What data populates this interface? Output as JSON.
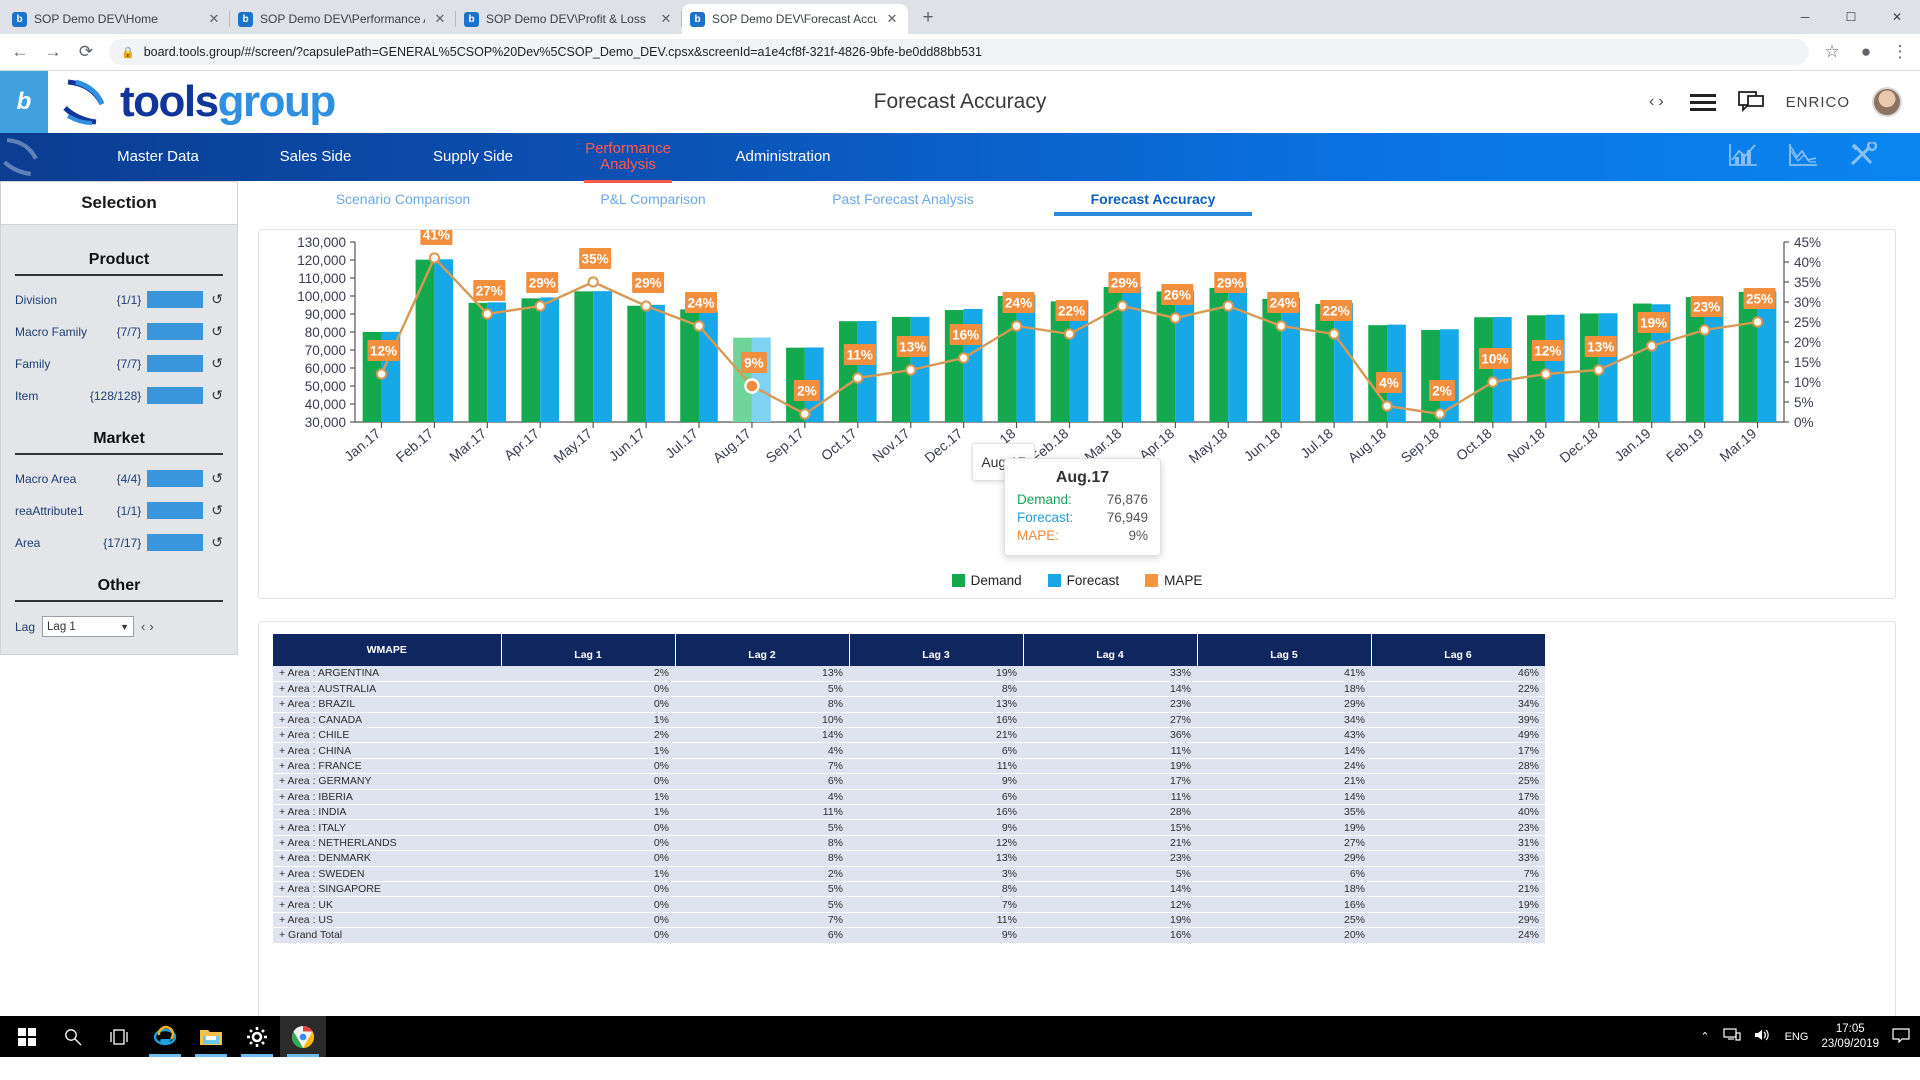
{
  "browser": {
    "tabs": [
      {
        "title": "SOP Demo DEV\\Home",
        "active": false
      },
      {
        "title": "SOP Demo DEV\\Performance An",
        "active": false
      },
      {
        "title": "SOP Demo DEV\\Profit & Loss",
        "active": false
      },
      {
        "title": "SOP Demo DEV\\Forecast Accura",
        "active": true
      }
    ],
    "favicon_letter": "b",
    "close_label": "✕",
    "newtab_label": "+",
    "window_controls": {
      "minimize": "─",
      "maximize": "☐",
      "close": "✕"
    },
    "back_icon": "←",
    "forward_icon": "→",
    "reload_icon": "⟳",
    "lock_icon": "🔒",
    "url": "board.tools.group/#/screen/?capsulePath=GENERAL%5CSOP%20Dev%5CSOP_Demo_DEV.cpsx&screenId=a1e4cf8f-321f-4826-9bfe-be0dd88bb531",
    "star_icon": "☆",
    "profile_icon": "●",
    "menu_icon": "⋮"
  },
  "app_header": {
    "badge_letter": "b",
    "logo_tools": "tools",
    "logo_group": "group",
    "title": "Forecast Accuracy",
    "prev_arrow": "‹",
    "next_arrow": "›",
    "user_name": "ENRICO"
  },
  "nav": {
    "items": [
      {
        "label": "Master Data",
        "active": false
      },
      {
        "label": "Sales Side",
        "active": false
      },
      {
        "label": "Supply Side",
        "active": false
      },
      {
        "label": "Performance\nAnalysis",
        "active": true
      },
      {
        "label": "Administration",
        "active": false
      }
    ],
    "active_color": "#ff5a4d"
  },
  "subtabs": [
    {
      "label": "Scenario Comparison",
      "active": false
    },
    {
      "label": "P&L Comparison",
      "active": false
    },
    {
      "label": "Past Forecast Analysis",
      "active": false
    },
    {
      "label": "Forecast Accuracy",
      "active": true
    }
  ],
  "sidebar": {
    "title": "Selection",
    "sections": [
      {
        "name": "Product",
        "rows": [
          {
            "label": "Division",
            "count": "{1/1}"
          },
          {
            "label": "Macro Family",
            "count": "{7/7}"
          },
          {
            "label": "Family",
            "count": "{7/7}"
          },
          {
            "label": "Item",
            "count": "{128/128}"
          }
        ]
      },
      {
        "name": "Market",
        "rows": [
          {
            "label": "Macro Area",
            "count": "{4/4}"
          },
          {
            "label": "reaAttribute1",
            "count": "{1/1}"
          },
          {
            "label": "Area",
            "count": "{17/17}"
          }
        ]
      }
    ],
    "other": {
      "name": "Other",
      "lag_label": "Lag",
      "lag_value": "Lag 1",
      "caret": "▼",
      "prev": "‹",
      "next": "›"
    },
    "reset_icon": "↺"
  },
  "tooltip": {
    "ghost_label": "Aug.17",
    "title": "Aug.17",
    "rows": [
      {
        "key": "Demand:",
        "value": "76,876"
      },
      {
        "key": "Forecast:",
        "value": "76,949"
      },
      {
        "key": "MAPE:",
        "value": "9%"
      }
    ]
  },
  "chart_data": {
    "type": "bar",
    "title": "",
    "xlabel": "",
    "ylabel": "",
    "y_left_label": "",
    "y_right_label": "",
    "ylim": [
      30000,
      130000
    ],
    "y2lim": [
      0,
      45
    ],
    "grid": false,
    "legend_position": "bottom",
    "highlighted_category": "Aug.17",
    "y_left_ticks": [
      "130,000",
      "120,000",
      "110,000",
      "100,000",
      "90,000",
      "80,000",
      "70,000",
      "60,000",
      "50,000",
      "40,000",
      "30,000"
    ],
    "y_right_ticks": [
      "45%",
      "40%",
      "35%",
      "30%",
      "25%",
      "20%",
      "15%",
      "10%",
      "5%",
      "0%"
    ],
    "categories": [
      "Jan.17",
      "Feb.17",
      "Mar.17",
      "Apr.17",
      "May.17",
      "Jun.17",
      "Jul.17",
      "Aug.17",
      "Sep.17",
      "Oct.17",
      "Nov.17",
      "Dec.17",
      "Jan.18",
      "Feb.18",
      "Mar.18",
      "Apr.18",
      "May.18",
      "Jun.18",
      "Jul.18",
      "Aug.18",
      "Sep.18",
      "Oct.18",
      "Nov.18",
      "Dec.18",
      "Jan.19",
      "Feb.19",
      "Mar.19"
    ],
    "series": [
      {
        "name": "Demand",
        "color": "#15a94f",
        "type": "bar",
        "values": [
          80000,
          120200,
          96200,
          98700,
          102600,
          94600,
          92600,
          76876,
          71300,
          86000,
          88400,
          92200,
          100000,
          97000,
          105000,
          102500,
          104500,
          98400,
          95600,
          83800,
          81100,
          88200,
          89300,
          90300,
          95800,
          99400,
          102300
        ]
      },
      {
        "name": "Forecast",
        "color": "#17a8e8",
        "type": "bar",
        "values": [
          80100,
          120400,
          96500,
          99200,
          102700,
          95100,
          91500,
          76949,
          71400,
          86100,
          88400,
          92800,
          100400,
          97400,
          105200,
          102900,
          104500,
          98900,
          96100,
          84100,
          81500,
          88300,
          89600,
          90400,
          95400,
          99600,
          102600
        ]
      },
      {
        "name": "MAPE",
        "color": "#f08a3c",
        "type": "line",
        "values": [
          12,
          41,
          27,
          29,
          35,
          29,
          24,
          9,
          2,
          11,
          13,
          16,
          24,
          22,
          29,
          26,
          29,
          24,
          22,
          4,
          2,
          10,
          12,
          13,
          19,
          23,
          25
        ]
      }
    ],
    "data_labels": [
      "12%",
      "41%",
      "27%",
      "29%",
      "35%",
      "29%",
      "24%",
      "9%",
      "2%",
      "11%",
      "13%",
      "16%",
      "24%",
      "22%",
      "29%",
      "26%",
      "29%",
      "24%",
      "22%",
      "4%",
      "2%",
      "10%",
      "12%",
      "13%",
      "19%",
      "23%",
      "25%"
    ]
  },
  "table": {
    "headers": [
      "WMAPE",
      "Lag 1",
      "Lag 2",
      "Lag 3",
      "Lag 4",
      "Lag 5",
      "Lag 6"
    ],
    "rows": [
      {
        "label": "+ Area : ARGENTINA",
        "values": [
          "2%",
          "13%",
          "19%",
          "33%",
          "41%",
          "46%"
        ]
      },
      {
        "label": "+ Area : AUSTRALIA",
        "values": [
          "0%",
          "5%",
          "8%",
          "14%",
          "18%",
          "22%"
        ]
      },
      {
        "label": "+ Area : BRAZIL",
        "values": [
          "0%",
          "8%",
          "13%",
          "23%",
          "29%",
          "34%"
        ]
      },
      {
        "label": "+ Area : CANADA",
        "values": [
          "1%",
          "10%",
          "16%",
          "27%",
          "34%",
          "39%"
        ]
      },
      {
        "label": "+ Area : CHILE",
        "values": [
          "2%",
          "14%",
          "21%",
          "36%",
          "43%",
          "49%"
        ]
      },
      {
        "label": "+ Area : CHINA",
        "values": [
          "1%",
          "4%",
          "6%",
          "11%",
          "14%",
          "17%"
        ]
      },
      {
        "label": "+ Area : FRANCE",
        "values": [
          "0%",
          "7%",
          "11%",
          "19%",
          "24%",
          "28%"
        ]
      },
      {
        "label": "+ Area : GERMANY",
        "values": [
          "0%",
          "6%",
          "9%",
          "17%",
          "21%",
          "25%"
        ]
      },
      {
        "label": "+ Area : IBERIA",
        "values": [
          "1%",
          "4%",
          "6%",
          "11%",
          "14%",
          "17%"
        ]
      },
      {
        "label": "+ Area : INDIA",
        "values": [
          "1%",
          "11%",
          "16%",
          "28%",
          "35%",
          "40%"
        ]
      },
      {
        "label": "+ Area : ITALY",
        "values": [
          "0%",
          "5%",
          "9%",
          "15%",
          "19%",
          "23%"
        ]
      },
      {
        "label": "+ Area : NETHERLANDS",
        "values": [
          "0%",
          "8%",
          "12%",
          "21%",
          "27%",
          "31%"
        ]
      },
      {
        "label": "+ Area : DENMARK",
        "values": [
          "0%",
          "8%",
          "13%",
          "23%",
          "29%",
          "33%"
        ]
      },
      {
        "label": "+ Area : SWEDEN",
        "values": [
          "1%",
          "2%",
          "3%",
          "5%",
          "6%",
          "7%"
        ]
      },
      {
        "label": "+ Area : SINGAPORE",
        "values": [
          "0%",
          "5%",
          "8%",
          "14%",
          "18%",
          "21%"
        ]
      },
      {
        "label": "+ Area : UK",
        "values": [
          "0%",
          "5%",
          "7%",
          "12%",
          "16%",
          "19%"
        ]
      },
      {
        "label": "+ Area : US",
        "values": [
          "0%",
          "7%",
          "11%",
          "19%",
          "25%",
          "29%"
        ]
      },
      {
        "label": "+ Grand Total",
        "values": [
          "0%",
          "6%",
          "9%",
          "16%",
          "20%",
          "24%"
        ]
      }
    ]
  },
  "taskbar": {
    "start_icon": "start-icon",
    "search_icon": "search-icon",
    "taskview_icon": "task-view-icon",
    "apps": [
      "internet-explorer-icon",
      "file-explorer-icon",
      "settings-icon",
      "chrome-icon"
    ],
    "chevron": "⌃",
    "network_icon": "network-icon",
    "volume_icon": "volume-icon",
    "language": "ENG",
    "time": "17:05",
    "date": "23/09/2019",
    "notification_icon": "notification-icon"
  }
}
